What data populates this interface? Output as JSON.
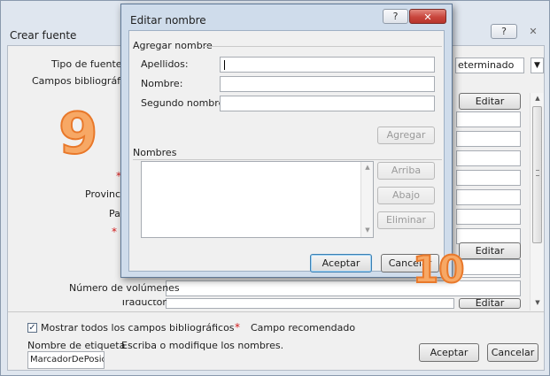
{
  "outer_dialog": {
    "title": "Crear fuente",
    "help_glyph": "?",
    "close_glyph": "✕",
    "source_type_label": "Tipo de fuente bib",
    "fields_label": "Campos bibliográficos d",
    "language_value": "eterminado",
    "edit_button_top": "Editar",
    "edit_button_mid": "Editar",
    "edit_button_bottom": "Editar",
    "province_label": "Provincia",
    "country_label": "País",
    "volumes_label": "Número de volúmenes",
    "translator_label": "Traductor",
    "show_all_label": "Mostrar todos los campos bibliográficos",
    "recommended_label": "Campo recomendado",
    "tag_name_label": "Nombre de etiqueta",
    "tag_name_hint": "Escriba o modifique los nombres.",
    "tag_name_value": "MarcadorDePosicio",
    "ok_button": "Aceptar",
    "cancel_button": "Cancelar",
    "star": "*"
  },
  "inner_dialog": {
    "title": "Editar nombre",
    "help_glyph": "?",
    "close_glyph": "✕",
    "add_name_group": "Agregar nombre",
    "surname_label": "Apellidos:",
    "name_label": "Nombre:",
    "middle_name_label": "Segundo nombre:",
    "add_button": "Agregar",
    "names_group": "Nombres",
    "up_button": "Arriba",
    "down_button": "Abajo",
    "delete_button": "Eliminar",
    "ok_button": "Aceptar",
    "cancel_button": "Cancelar"
  },
  "annotations": {
    "step_a": "9",
    "step_b": "10"
  },
  "colors": {
    "annotation_fill": "#f7a865",
    "annotation_stroke": "#e8782a",
    "close_button": "#c9463d"
  }
}
